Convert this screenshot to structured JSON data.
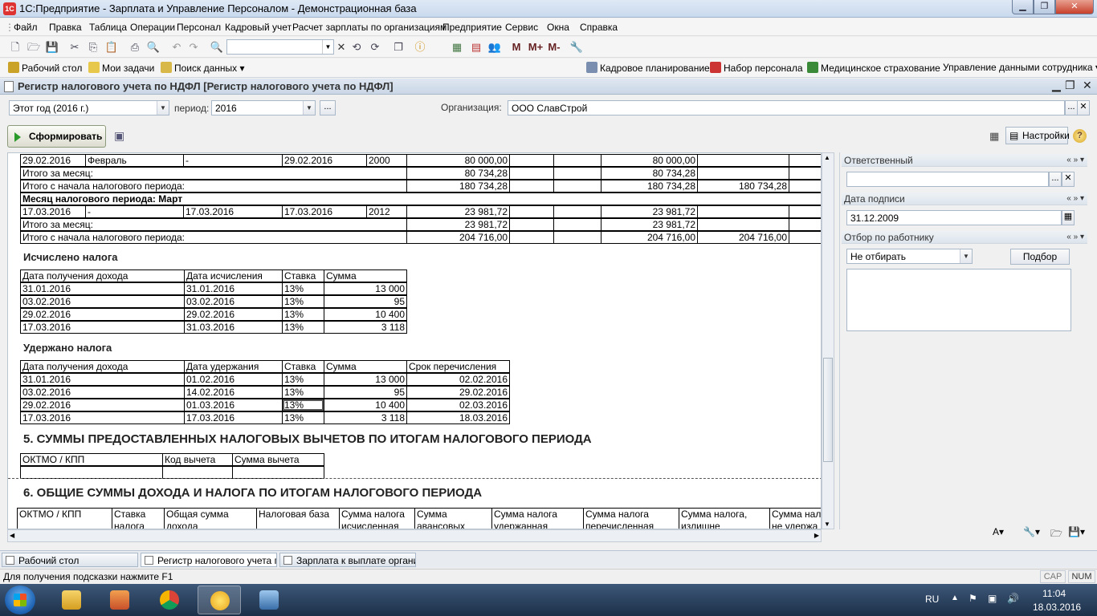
{
  "window": {
    "title": "1С:Предприятие - Зарплата и Управление Персоналом - Демонстрационная база",
    "app_icon": "1С"
  },
  "menu": [
    "Файл",
    "Правка",
    "Таблица",
    "Операции",
    "Персонал",
    "Кадровый учет",
    "Расчет зарплаты по организациям",
    "Предприятие",
    "Сервис",
    "Окна",
    "Справка"
  ],
  "toolbar": {
    "search_value": "",
    "icons": [
      "new-icon",
      "open-icon",
      "save-icon",
      "cut-icon",
      "copy-icon",
      "paste-icon",
      "print-icon",
      "preview-icon",
      "undo-icon",
      "redo-icon",
      "find-icon",
      "search-back-icon",
      "search-next-icon",
      "windows-icon",
      "info-icon",
      "calculator-icon",
      "calendar-icon",
      "users-icon",
      "m-icon",
      "m-plus-icon",
      "m-minus-icon",
      "tools-icon"
    ],
    "m_label": "M",
    "mplus_label": "M+",
    "mminus_label": "M-"
  },
  "panels": {
    "left": [
      "Рабочий стол",
      "Мои задачи",
      "Поиск данных"
    ],
    "right": [
      "Кадровое планирование",
      "Набор персонала",
      "Медицинское страхование",
      "Управление данными сотрудника"
    ]
  },
  "document": {
    "title": "Регистр налогового учета по НДФЛ [Регистр налогового учета по НДФЛ]",
    "period_preset": "Этот год (2016 г.)",
    "period_label": "период:",
    "period_value": "2016",
    "org_label": "Организация:",
    "org_value": "ООО СлавСтрой",
    "generate_button": "Сформировать",
    "settings_button": "Настройки",
    "help_icon": "?"
  },
  "report": {
    "income_rows": [
      {
        "c1": "29.02.2016",
        "c2": "Февраль",
        "c3": "-",
        "c4": "29.02.2016",
        "c5": "2000",
        "c6": "80 000,00",
        "c7": "",
        "c8": "",
        "c9": "80 000,00",
        "c10": ""
      },
      {
        "label": "Итого за месяц:",
        "c6": "80 734,28",
        "c9": "80 734,28",
        "c10": ""
      },
      {
        "label": "Итого с начала налогового периода:",
        "c6": "180 734,28",
        "c9": "180 734,28",
        "c10": "180 734,28"
      },
      {
        "month": "Месяц налогового периода: Март"
      },
      {
        "c1": "17.03.2016",
        "c2": "-",
        "c3": "17.03.2016",
        "c4": "17.03.2016",
        "c5": "2012",
        "c6": "23 981,72",
        "c7": "",
        "c8": "",
        "c9": "23 981,72",
        "c10": ""
      },
      {
        "label": "Итого за месяц:",
        "c6": "23 981,72",
        "c9": "23 981,72",
        "c10": ""
      },
      {
        "label": "Итого с начала налогового периода:",
        "c6": "204 716,00",
        "c9": "204 716,00",
        "c10": "204 716,00"
      }
    ],
    "calc_title": "Исчислено налога",
    "calc_headers": [
      "Дата получения дохода",
      "Дата исчисления",
      "Ставка",
      "Сумма"
    ],
    "calc_rows": [
      [
        "31.01.2016",
        "31.01.2016",
        "13%",
        "13 000"
      ],
      [
        "03.02.2016",
        "03.02.2016",
        "13%",
        "95"
      ],
      [
        "29.02.2016",
        "29.02.2016",
        "13%",
        "10 400"
      ],
      [
        "17.03.2016",
        "31.03.2016",
        "13%",
        "3 118"
      ]
    ],
    "withheld_title": "Удержано налога",
    "withheld_headers": [
      "Дата получения дохода",
      "Дата удержания",
      "Ставка",
      "Сумма",
      "Срок перечисления"
    ],
    "withheld_rows": [
      [
        "31.01.2016",
        "01.02.2016",
        "13%",
        "13 000",
        "02.02.2016"
      ],
      [
        "03.02.2016",
        "14.02.2016",
        "13%",
        "95",
        "29.02.2016"
      ],
      [
        "29.02.2016",
        "01.03.2016",
        "13%",
        "10 400",
        "02.03.2016"
      ],
      [
        "17.03.2016",
        "17.03.2016",
        "13%",
        "3 118",
        "18.03.2016"
      ]
    ],
    "section5_title": "5. СУММЫ ПРЕДОСТАВЛЕННЫХ НАЛОГОВЫХ ВЫЧЕТОВ ПО ИТОГАМ НАЛОГОВОГО ПЕРИОДА",
    "section5_headers": [
      "ОКТМО / КПП",
      "Код вычета",
      "Сумма вычета"
    ],
    "section6_title": "6. ОБЩИЕ СУММЫ ДОХОДА И НАЛОГА ПО ИТОГАМ НАЛОГОВОГО ПЕРИОДА",
    "section6_headers": [
      [
        "ОКТМО / КПП",
        ""
      ],
      [
        "Ставка",
        "налога"
      ],
      [
        "Общая сумма",
        "дохода"
      ],
      [
        "Налоговая база",
        ""
      ],
      [
        "Сумма налога",
        "исчисленная"
      ],
      [
        "Сумма",
        "авансовых"
      ],
      [
        "Сумма налога",
        "удержанная"
      ],
      [
        "Сумма налога",
        "перечисленная"
      ],
      [
        "Сумма налога,",
        "излишне"
      ],
      [
        "Сумма налога",
        "не удержа"
      ]
    ]
  },
  "settings_panel": {
    "responsible_label": "Ответственный",
    "responsible_value": "",
    "sign_date_label": "Дата подписи",
    "sign_date_value": "31.12.2009",
    "filter_label": "Отбор по работнику",
    "filter_value": "Не отбирать",
    "select_button": "Подбор"
  },
  "windows_bar": [
    "Рабочий стол",
    "Регистр налогового учета п...",
    "Зарплата к выплате органи..."
  ],
  "status": {
    "hint": "Для получения подсказки нажмите F1",
    "cap": "CAP",
    "num": "NUM"
  },
  "taskbar": {
    "lang": "RU",
    "time": "11:04",
    "date": "18.03.2016"
  }
}
